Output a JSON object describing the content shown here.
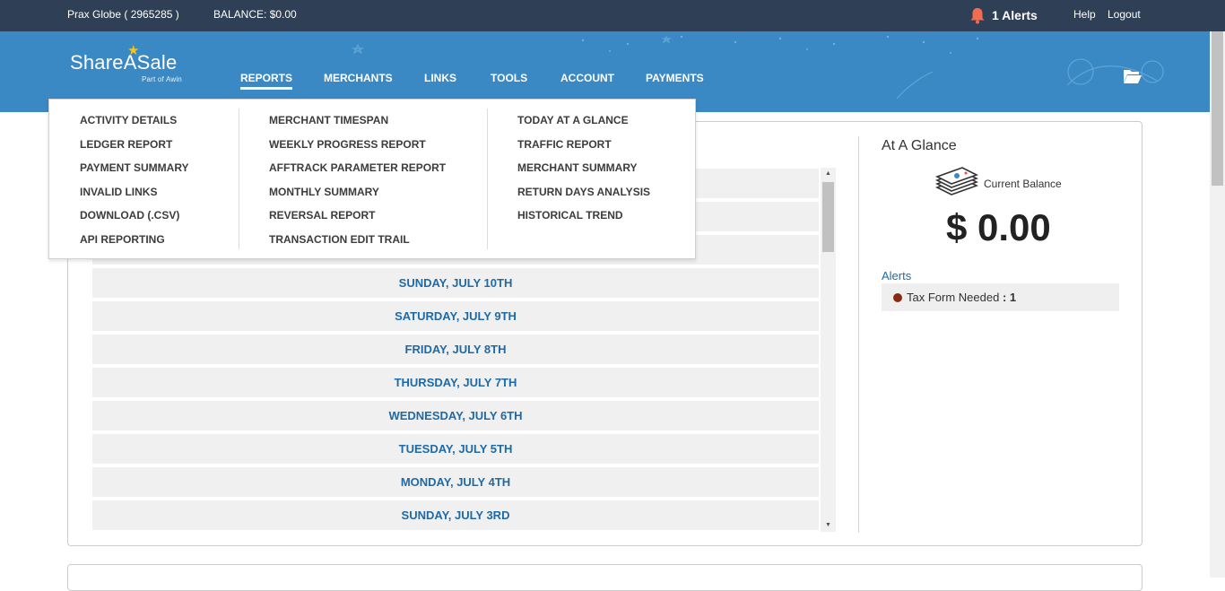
{
  "topbar": {
    "account": "Prax Globe ( 2965285 )",
    "balance": "BALANCE: $0.00",
    "alerts": "1 Alerts",
    "help": "Help",
    "logout": "Logout"
  },
  "brand": {
    "name": "ShareASale",
    "sub": "Part of Awin"
  },
  "nav": [
    "REPORTS",
    "MERCHANTS",
    "LINKS",
    "TOOLS",
    "ACCOUNT",
    "PAYMENTS"
  ],
  "dropdown": {
    "col1": [
      "ACTIVITY DETAILS",
      "LEDGER REPORT",
      "PAYMENT SUMMARY",
      "INVALID LINKS",
      "DOWNLOAD (.CSV)",
      "API REPORTING"
    ],
    "col2": [
      "MERCHANT TIMESPAN",
      "WEEKLY PROGRESS REPORT",
      "AFFTRACK PARAMETER REPORT",
      "MONTHLY SUMMARY",
      "REVERSAL REPORT",
      "TRANSACTION EDIT TRAIL"
    ],
    "col3": [
      "TODAY AT A GLANCE",
      "TRAFFIC REPORT",
      "MERCHANT SUMMARY",
      "RETURN DAYS ANALYSIS",
      "HISTORICAL TREND"
    ]
  },
  "days": [
    "",
    "",
    "",
    "SUNDAY, JULY 10TH",
    "SATURDAY, JULY 9TH",
    "FRIDAY, JULY 8TH",
    "THURSDAY, JULY 7TH",
    "WEDNESDAY, JULY 6TH",
    "TUESDAY, JULY 5TH",
    "MONDAY, JULY 4TH",
    "SUNDAY, JULY 3RD"
  ],
  "glance": {
    "title": "At A Glance",
    "current_balance_label": "Current Balance",
    "current_balance_value": "$ 0.00",
    "alerts_label": "Alerts",
    "alert_item_label": "Tax Form Needed",
    "alert_item_count": "1"
  },
  "colors": {
    "topbar": "#2f3f55",
    "banner": "#3a89c4",
    "link": "#1f6aa6",
    "alert_dot": "#8b2a12",
    "bell": "#f26c4f"
  },
  "icons": [
    "bell-icon",
    "folder-open-icon",
    "money-stack-icon",
    "star-icon"
  ]
}
